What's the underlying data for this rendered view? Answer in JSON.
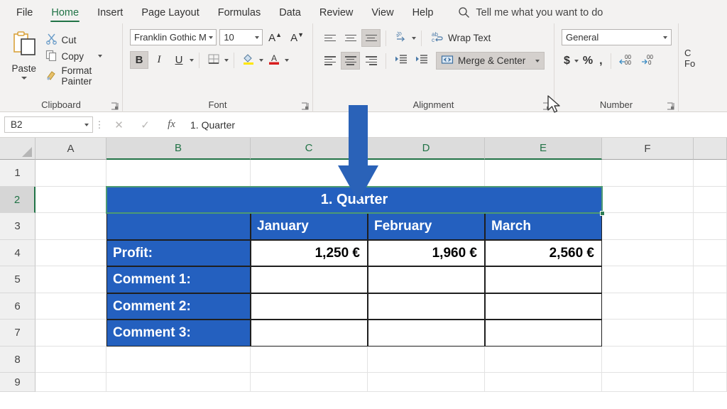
{
  "app": {
    "accent_green": "#217346",
    "table_blue": "#2460bf",
    "arrow_blue": "#2a62b8"
  },
  "ribbon_tabs": [
    {
      "label": "File",
      "active": false
    },
    {
      "label": "Home",
      "active": true
    },
    {
      "label": "Insert",
      "active": false
    },
    {
      "label": "Page Layout",
      "active": false
    },
    {
      "label": "Formulas",
      "active": false
    },
    {
      "label": "Data",
      "active": false
    },
    {
      "label": "Review",
      "active": false
    },
    {
      "label": "View",
      "active": false
    },
    {
      "label": "Help",
      "active": false
    }
  ],
  "tell_me": {
    "label": "Tell me what you want to do",
    "icon": "search-icon"
  },
  "groups": {
    "clipboard": {
      "label": "Clipboard",
      "paste": "Paste",
      "cut": "Cut",
      "copy": "Copy",
      "format_painter": "Format Painter"
    },
    "font": {
      "label": "Font",
      "font_name": "Franklin Gothic M",
      "font_size": "10",
      "grow_font": "A",
      "shrink_font": "A",
      "bold": "B",
      "italic": "I",
      "underline": "U",
      "bold_active": true
    },
    "alignment": {
      "label": "Alignment",
      "wrap_text": "Wrap Text",
      "merge_center": "Merge & Center",
      "merge_center_active": true
    },
    "number": {
      "label": "Number",
      "format": "General",
      "currency": "$",
      "percent": "%",
      "comma": ",",
      "increase_decimal": "increase-decimal-icon",
      "decrease_decimal": "decrease-decimal-icon"
    },
    "styles": {
      "line1": "C",
      "line2": "Fo"
    }
  },
  "formula_bar": {
    "name_box": "B2",
    "cancel": "cancel-icon",
    "enter": "enter-icon",
    "insert_function": "fx",
    "value": "1. Quarter"
  },
  "grid": {
    "columns": [
      "A",
      "B",
      "C",
      "D",
      "E",
      "F"
    ],
    "selected_columns": [
      "B",
      "C",
      "D",
      "E"
    ],
    "rows": [
      "1",
      "2",
      "3",
      "4",
      "5",
      "6",
      "7",
      "8",
      "9"
    ],
    "selected_rows": [
      "2"
    ],
    "selection_range": "B2:E2"
  },
  "sheet_table": {
    "merged_title": "1. Quarter",
    "month_headers": [
      "January",
      "February",
      "March"
    ],
    "rows": [
      {
        "label": "Profit:",
        "values": [
          "1,250 €",
          "1,960 €",
          "2,560 €"
        ]
      },
      {
        "label": "Comment 1:",
        "values": [
          "",
          "",
          ""
        ]
      },
      {
        "label": "Comment 2:",
        "values": [
          "",
          "",
          ""
        ]
      },
      {
        "label": "Comment 3:",
        "values": [
          "",
          "",
          ""
        ]
      }
    ]
  },
  "overlay": {
    "arrow": "down-arrow-annotation",
    "cursor": "mouse-pointer"
  }
}
